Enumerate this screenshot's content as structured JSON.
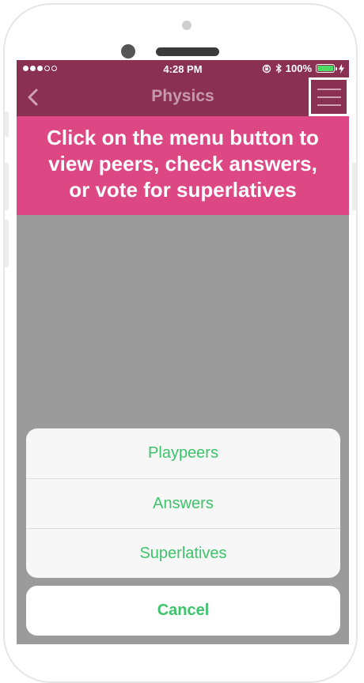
{
  "status_bar": {
    "time": "4:28 PM",
    "battery_percent": "100%",
    "signal_bars_filled": 3,
    "signal_bars_total": 5,
    "icons": [
      "signal-dots-icon",
      "orientation-lock-icon",
      "bluetooth-icon",
      "battery-icon",
      "charging-bolt-icon"
    ]
  },
  "nav": {
    "title": "Physics",
    "back_icon": "chevron-left-icon",
    "menu_icon": "hamburger-menu-icon"
  },
  "banner": {
    "lines": [
      "Click on the menu button to",
      "view peers, check answers,",
      "or vote for superlatives"
    ]
  },
  "action_sheet": {
    "items": [
      "Playpeers",
      "Answers",
      "Superlatives"
    ],
    "cancel_label": "Cancel"
  },
  "colors": {
    "nav_background": "#8a3152",
    "banner_background": "#dc4784",
    "action_text": "#3cc46a",
    "overlay": "#9b9b9b"
  }
}
